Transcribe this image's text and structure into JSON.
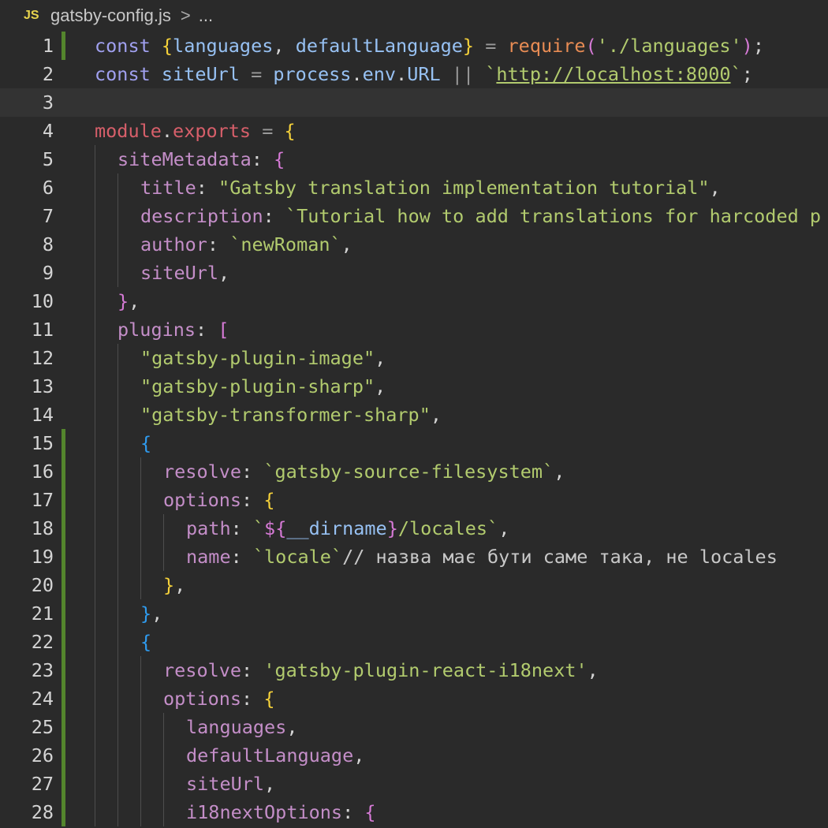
{
  "breadcrumb": {
    "language_badge": "JS",
    "file_name": "gatsby-config.js",
    "separator": ">",
    "more": "..."
  },
  "colors": {
    "background": "#2a2a2a",
    "current_line": "#333333",
    "git_modified_bar": "#54852d",
    "string": "#b2cb6e",
    "property": "#c48ec8",
    "keyword": "#a0a0ef"
  },
  "lines": [
    {
      "num": "1",
      "git": true,
      "current": false,
      "indent": 0,
      "tokens": [
        {
          "c": "kw",
          "t": "const "
        },
        {
          "c": "br-y",
          "t": "{"
        },
        {
          "c": "var",
          "t": "languages"
        },
        {
          "c": "punc",
          "t": ", "
        },
        {
          "c": "var",
          "t": "defaultLanguage"
        },
        {
          "c": "br-y",
          "t": "}"
        },
        {
          "c": "op",
          "t": " = "
        },
        {
          "c": "fn",
          "t": "require"
        },
        {
          "c": "br-p",
          "t": "("
        },
        {
          "c": "str",
          "t": "'./languages'"
        },
        {
          "c": "br-p",
          "t": ")"
        },
        {
          "c": "punc",
          "t": ";"
        }
      ]
    },
    {
      "num": "2",
      "git": false,
      "current": false,
      "indent": 0,
      "tokens": [
        {
          "c": "kw",
          "t": "const "
        },
        {
          "c": "var",
          "t": "siteUrl"
        },
        {
          "c": "op",
          "t": " = "
        },
        {
          "c": "var",
          "t": "process"
        },
        {
          "c": "punc",
          "t": "."
        },
        {
          "c": "var",
          "t": "env"
        },
        {
          "c": "punc",
          "t": "."
        },
        {
          "c": "var",
          "t": "URL"
        },
        {
          "c": "op",
          "t": " || "
        },
        {
          "c": "str",
          "t": "`"
        },
        {
          "c": "str url",
          "t": "http://localhost:8000"
        },
        {
          "c": "str",
          "t": "`"
        },
        {
          "c": "punc",
          "t": ";"
        }
      ]
    },
    {
      "num": "3",
      "git": false,
      "current": true,
      "indent": 0,
      "tokens": []
    },
    {
      "num": "4",
      "git": false,
      "current": false,
      "indent": 0,
      "tokens": [
        {
          "c": "kw2",
          "t": "module"
        },
        {
          "c": "punc",
          "t": "."
        },
        {
          "c": "kw2",
          "t": "exports"
        },
        {
          "c": "op",
          "t": " = "
        },
        {
          "c": "br-y",
          "t": "{"
        }
      ]
    },
    {
      "num": "5",
      "git": false,
      "current": false,
      "indent": 1,
      "tokens": [
        {
          "c": "prop",
          "t": "siteMetadata"
        },
        {
          "c": "punc",
          "t": ": "
        },
        {
          "c": "br-p",
          "t": "{"
        }
      ]
    },
    {
      "num": "6",
      "git": false,
      "current": false,
      "indent": 2,
      "tokens": [
        {
          "c": "prop",
          "t": "title"
        },
        {
          "c": "punc",
          "t": ": "
        },
        {
          "c": "str",
          "t": "\"Gatsby translation implementation tutorial\""
        },
        {
          "c": "punc",
          "t": ","
        }
      ]
    },
    {
      "num": "7",
      "git": false,
      "current": false,
      "indent": 2,
      "tokens": [
        {
          "c": "prop",
          "t": "description"
        },
        {
          "c": "punc",
          "t": ": "
        },
        {
          "c": "str",
          "t": "`Tutorial how to add translations for harcoded p"
        }
      ]
    },
    {
      "num": "8",
      "git": false,
      "current": false,
      "indent": 2,
      "tokens": [
        {
          "c": "prop",
          "t": "author"
        },
        {
          "c": "punc",
          "t": ": "
        },
        {
          "c": "str",
          "t": "`newRoman`"
        },
        {
          "c": "punc",
          "t": ","
        }
      ]
    },
    {
      "num": "9",
      "git": false,
      "current": false,
      "indent": 2,
      "tokens": [
        {
          "c": "prop",
          "t": "siteUrl"
        },
        {
          "c": "punc",
          "t": ","
        }
      ]
    },
    {
      "num": "10",
      "git": false,
      "current": false,
      "indent": 1,
      "tokens": [
        {
          "c": "br-p",
          "t": "}"
        },
        {
          "c": "punc",
          "t": ","
        }
      ]
    },
    {
      "num": "11",
      "git": false,
      "current": false,
      "indent": 1,
      "tokens": [
        {
          "c": "prop",
          "t": "plugins"
        },
        {
          "c": "punc",
          "t": ": "
        },
        {
          "c": "br-p",
          "t": "["
        }
      ]
    },
    {
      "num": "12",
      "git": false,
      "current": false,
      "indent": 2,
      "tokens": [
        {
          "c": "str",
          "t": "\"gatsby-plugin-image\""
        },
        {
          "c": "punc",
          "t": ","
        }
      ]
    },
    {
      "num": "13",
      "git": false,
      "current": false,
      "indent": 2,
      "tokens": [
        {
          "c": "str",
          "t": "\"gatsby-plugin-sharp\""
        },
        {
          "c": "punc",
          "t": ","
        }
      ]
    },
    {
      "num": "14",
      "git": false,
      "current": false,
      "indent": 2,
      "tokens": [
        {
          "c": "str",
          "t": "\"gatsby-transformer-sharp\""
        },
        {
          "c": "punc",
          "t": ","
        }
      ]
    },
    {
      "num": "15",
      "git": true,
      "current": false,
      "indent": 2,
      "tokens": [
        {
          "c": "br-b",
          "t": "{"
        }
      ]
    },
    {
      "num": "16",
      "git": true,
      "current": false,
      "indent": 3,
      "tokens": [
        {
          "c": "prop",
          "t": "resolve"
        },
        {
          "c": "punc",
          "t": ": "
        },
        {
          "c": "str",
          "t": "`gatsby-source-filesystem`"
        },
        {
          "c": "punc",
          "t": ","
        }
      ]
    },
    {
      "num": "17",
      "git": true,
      "current": false,
      "indent": 3,
      "tokens": [
        {
          "c": "prop",
          "t": "options"
        },
        {
          "c": "punc",
          "t": ": "
        },
        {
          "c": "br-y",
          "t": "{"
        }
      ]
    },
    {
      "num": "18",
      "git": true,
      "current": false,
      "indent": 4,
      "tokens": [
        {
          "c": "prop",
          "t": "path"
        },
        {
          "c": "punc",
          "t": ": "
        },
        {
          "c": "str",
          "t": "`"
        },
        {
          "c": "tpl",
          "t": "${"
        },
        {
          "c": "var",
          "t": "__dirname"
        },
        {
          "c": "tpl",
          "t": "}"
        },
        {
          "c": "str",
          "t": "/locales`"
        },
        {
          "c": "punc",
          "t": ","
        }
      ]
    },
    {
      "num": "19",
      "git": true,
      "current": false,
      "indent": 4,
      "tokens": [
        {
          "c": "prop",
          "t": "name"
        },
        {
          "c": "punc",
          "t": ": "
        },
        {
          "c": "str",
          "t": "`locale`"
        },
        {
          "c": "cmt",
          "t": "// назва має бути саме така, не locales"
        }
      ]
    },
    {
      "num": "20",
      "git": true,
      "current": false,
      "indent": 3,
      "tokens": [
        {
          "c": "br-y",
          "t": "}"
        },
        {
          "c": "punc",
          "t": ","
        }
      ]
    },
    {
      "num": "21",
      "git": true,
      "current": false,
      "indent": 2,
      "tokens": [
        {
          "c": "br-b",
          "t": "}"
        },
        {
          "c": "punc",
          "t": ","
        }
      ]
    },
    {
      "num": "22",
      "git": true,
      "current": false,
      "indent": 2,
      "tokens": [
        {
          "c": "br-b",
          "t": "{"
        }
      ]
    },
    {
      "num": "23",
      "git": true,
      "current": false,
      "indent": 3,
      "tokens": [
        {
          "c": "prop",
          "t": "resolve"
        },
        {
          "c": "punc",
          "t": ": "
        },
        {
          "c": "str",
          "t": "'gatsby-plugin-react-i18next'"
        },
        {
          "c": "punc",
          "t": ","
        }
      ]
    },
    {
      "num": "24",
      "git": true,
      "current": false,
      "indent": 3,
      "tokens": [
        {
          "c": "prop",
          "t": "options"
        },
        {
          "c": "punc",
          "t": ": "
        },
        {
          "c": "br-y",
          "t": "{"
        }
      ]
    },
    {
      "num": "25",
      "git": true,
      "current": false,
      "indent": 4,
      "tokens": [
        {
          "c": "prop",
          "t": "languages"
        },
        {
          "c": "punc",
          "t": ","
        }
      ]
    },
    {
      "num": "26",
      "git": true,
      "current": false,
      "indent": 4,
      "tokens": [
        {
          "c": "prop",
          "t": "defaultLanguage"
        },
        {
          "c": "punc",
          "t": ","
        }
      ]
    },
    {
      "num": "27",
      "git": true,
      "current": false,
      "indent": 4,
      "tokens": [
        {
          "c": "prop",
          "t": "siteUrl"
        },
        {
          "c": "punc",
          "t": ","
        }
      ]
    },
    {
      "num": "28",
      "git": true,
      "current": false,
      "indent": 4,
      "tokens": [
        {
          "c": "prop",
          "t": "i18nextOptions"
        },
        {
          "c": "punc",
          "t": ": "
        },
        {
          "c": "br-p",
          "t": "{"
        }
      ]
    }
  ]
}
